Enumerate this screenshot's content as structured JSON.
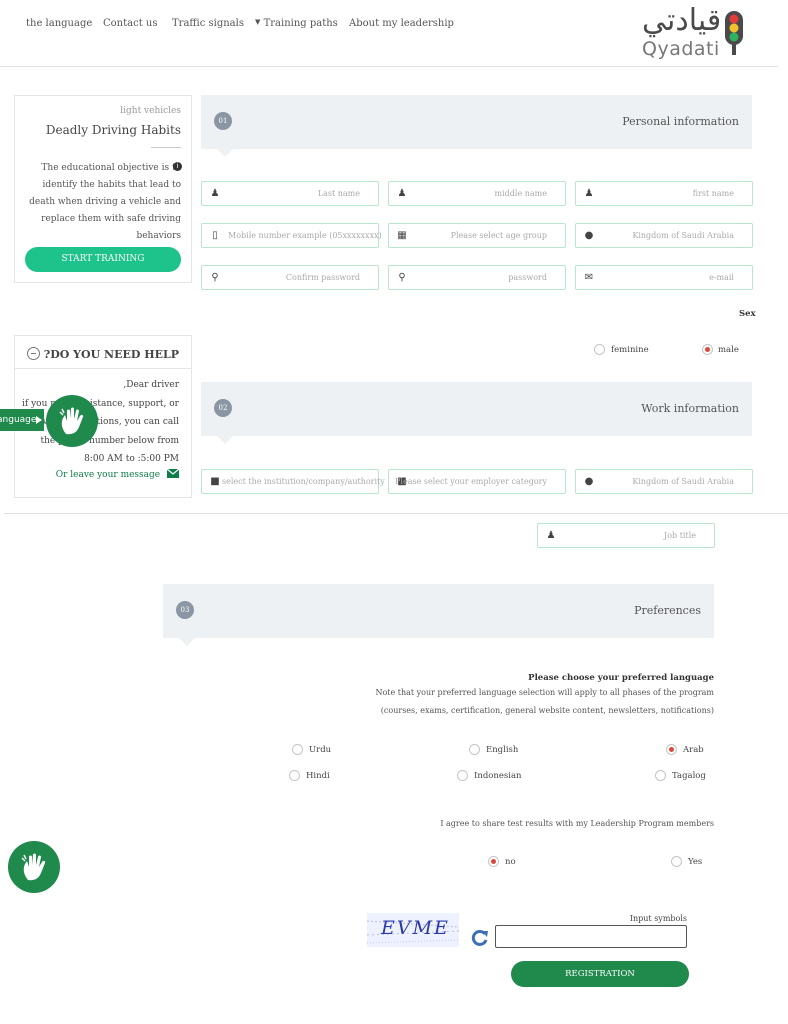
{
  "nav": {
    "items": [
      "the language",
      "Contact us",
      "Traffic signals",
      "Training paths",
      "About my leadership"
    ]
  },
  "logo": {
    "arabic": "قيادتي",
    "latin": "Qyadati"
  },
  "course": {
    "category": "light vehicles",
    "title": "Deadly Driving Habits",
    "description": "The educational objective is to identify the habits that lead to death when driving a vehicle and replace them with safe driving behaviors",
    "start_button": "START TRAINING"
  },
  "help": {
    "title": "?DO YOU NEED HELP",
    "greeting": ",Dear driver",
    "body": "if you need assistance, support, or have any questions, you can call the phone number below from 8:00 AM to :5:00 PM",
    "message_link": "Or leave your message"
  },
  "sign_language": {
    "tab_label": "Language"
  },
  "section1": {
    "number": "01",
    "title": "Personal information",
    "fields": {
      "last_name": "Last name",
      "middle_name": "middle name",
      "first_name": "first name",
      "mobile": "Mobile number example (05xxxxxxxx)",
      "age_group": "Please select age group",
      "country": "Kingdom of Saudi Arabia",
      "confirm_password": "Confirm password",
      "password": "password",
      "email": "e-mail"
    },
    "sex_label": "Sex",
    "sex_options": {
      "feminine": "feminine",
      "male": "male"
    },
    "sex_selected": "male"
  },
  "section2": {
    "number": "02",
    "title": "Work information",
    "fields": {
      "institution": "select the institution/company/authority",
      "employer_category": "Please select your employer category",
      "country": "Kingdom of Saudi Arabia",
      "job_title": "Job title"
    }
  },
  "section3": {
    "number": "03",
    "title": "Preferences",
    "language_heading": "Please choose your preferred language",
    "language_note_1": "Note that your preferred language selection will apply to all phases of the program",
    "language_note_2": "(courses, exams, certification, general website content, newsletters, notifications)",
    "languages": {
      "urdu": "Urdu",
      "english": "English",
      "arab": "Arab",
      "hindi": "Hindi",
      "indonesian": "Indonesian",
      "tagalog": "Tagalog"
    },
    "language_selected": "Arab",
    "share_question": "I agree to share test results with my Leadership Program members",
    "share_options": {
      "no": "no",
      "yes": "Yes"
    },
    "share_selected": "no"
  },
  "captcha": {
    "code": "EVME",
    "input_label": "Input symbols"
  },
  "register_button": "REGISTRATION",
  "colors": {
    "brand_green": "#1f8a4c",
    "button_green": "#1ec28b",
    "dark_green": "#0f7d4a",
    "section_bg": "#eef1f4",
    "field_border": "#b9e6cc",
    "radio_selected": "#d9493c"
  },
  "icons": [
    "user-icon",
    "phone-icon",
    "calendar-icon",
    "globe-icon",
    "key-icon",
    "envelope-icon",
    "building-icon",
    "info-icon",
    "refresh-icon",
    "hand-sign-icon",
    "caret-down-icon",
    "minus-circle-icon"
  ]
}
